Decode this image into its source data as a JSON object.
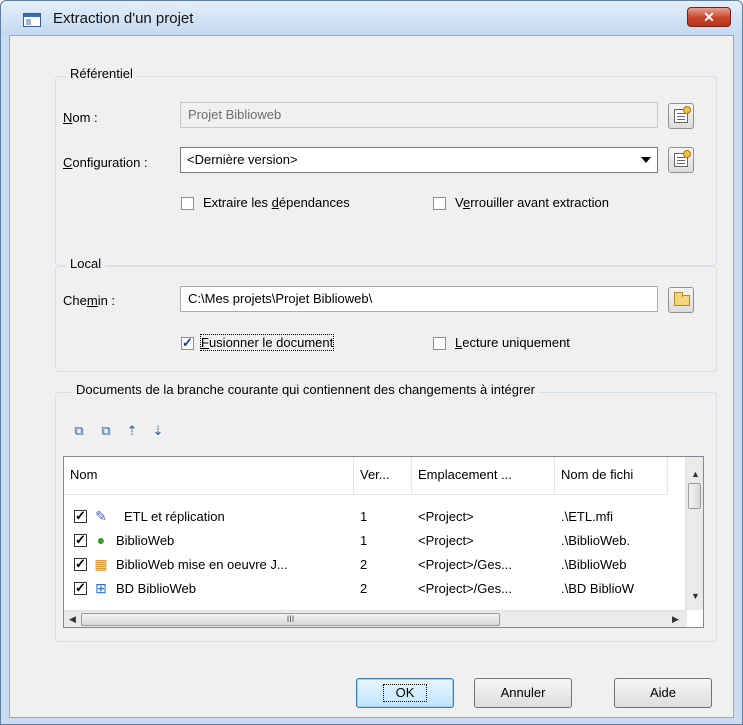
{
  "window": {
    "title": "Extraction d'un projet",
    "close_label": "✕"
  },
  "referentiel": {
    "group_label": "Référentiel",
    "nom_label_first": "N",
    "nom_label_rest": "om :",
    "nom_value": "Projet Biblioweb",
    "configuration_label_first": "C",
    "configuration_label_rest": "onfiguration :",
    "configuration_value": "<Dernière version>",
    "extraire_label_pre": "Extraire les ",
    "extraire_label_u": "d",
    "extraire_label_post": "épendances",
    "extraire_checked": false,
    "verrouiller_label_pre": "V",
    "verrouiller_label_u": "e",
    "verrouiller_label_post": "rrouiller avant extraction",
    "verrouiller_checked": false
  },
  "local": {
    "group_label": "Local",
    "chemin_label_pre": "Che",
    "chemin_label_u": "m",
    "chemin_label_post": "in :",
    "chemin_value": "C:\\Mes projets\\Projet Biblioweb\\",
    "fusionner_label_u": "F",
    "fusionner_label_post": "usionner le document",
    "fusionner_checked": true,
    "lecture_label_u": "L",
    "lecture_label_post": "ecture uniquement",
    "lecture_checked": false
  },
  "documents": {
    "group_label": "Documents de la branche courante qui contiennent des changements à intégrer",
    "toolbar_icons": [
      "select-all-icon",
      "deselect-all-icon",
      "move-up-icon",
      "move-down-icon"
    ],
    "columns": [
      "Nom",
      "Ver...",
      "Emplacement ...",
      "Nom de fichi"
    ],
    "rows": [
      {
        "name": "ETL et réplication",
        "version": "1",
        "location": "<Project>",
        "file": ".\\ETL.mfi",
        "icon": "etl-model-icon",
        "checked": true
      },
      {
        "name": "BiblioWeb",
        "version": "1",
        "location": "<Project>",
        "file": ".\\BiblioWeb.",
        "icon": "business-process-icon",
        "checked": true
      },
      {
        "name": "BiblioWeb mise en oeuvre J...",
        "version": "2",
        "location": "<Project>/Ges...",
        "file": ".\\BiblioWeb",
        "icon": "oo-model-icon",
        "checked": true
      },
      {
        "name": "BD BiblioWeb",
        "version": "2",
        "location": "<Project>/Ges...",
        "file": ".\\BD BiblioW",
        "icon": "physical-data-model-icon",
        "checked": true
      }
    ],
    "hscroll_grip": "III"
  },
  "buttons": {
    "ok": "OK",
    "annuler": "Annuler",
    "aide": "Aide"
  }
}
